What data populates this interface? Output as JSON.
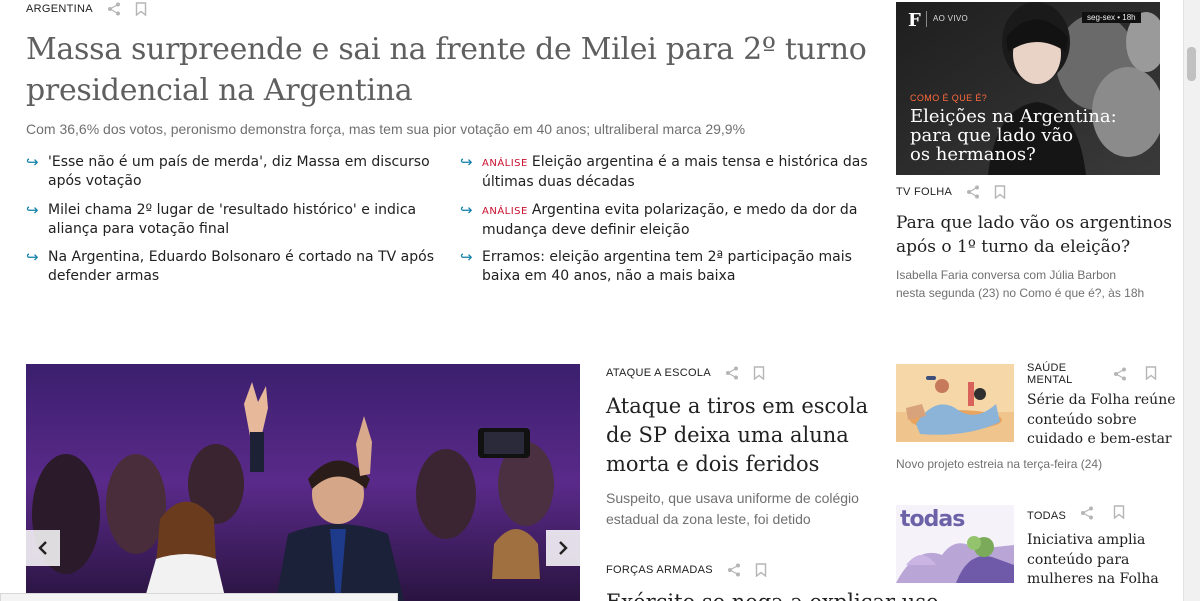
{
  "top_story": {
    "kicker": "ARGENTINA",
    "headline_line1": "Massa surpreende e sai na frente de Milei para 2º turno",
    "headline_line2": "presidencial na Argentina",
    "subtitle": "Com 36,6% dos votos, peronismo demonstra força, mas tem sua pior votação em 40 anos; ultraliberal marca 29,9%",
    "related": [
      {
        "tag": "",
        "text_line1": "'Esse não é um país de merda', diz Massa em discurso",
        "text_line2": "após votação"
      },
      {
        "tag": "",
        "text_line1": "Milei chama 2º lugar de 'resultado histórico' e indica",
        "text_line2": "aliança para votação final"
      },
      {
        "tag": "",
        "text_line1": "Na Argentina, Eduardo Bolsonaro é cortado na TV após",
        "text_line2": "defender armas"
      },
      {
        "tag": "ANÁLISE",
        "text_line1": "Eleição argentina é a mais tensa e histórica das",
        "text_line2": "últimas duas décadas"
      },
      {
        "tag": "ANÁLISE",
        "text_line1": "Argentina evita polarização, e medo da dor da",
        "text_line2": "mudança deve definir eleição"
      },
      {
        "tag": "",
        "text_line1": "Erramos: eleição argentina tem 2ª participação mais",
        "text_line2": "baixa em 40 anos, não a mais baixa"
      }
    ]
  },
  "video_card": {
    "logo": "F",
    "live_label": "AO VIVO",
    "schedule": "seg-sex • 18h",
    "kicker": "COMO É QUE É?",
    "title_line1": "Eleições na Argentina:",
    "title_line2": "para que lado vão",
    "title_line3": "os hermanos?",
    "section": "TV FOLHA",
    "headline_line1": "Para que lado vão os argentinos",
    "headline_line2": "após o 1º turno da eleição?",
    "desc_line1": "Isabella Faria conversa com Júlia Barbon",
    "desc_line2": "nesta segunda (23) no Como é que é?, às 18h"
  },
  "middle": {
    "story1": {
      "kicker": "ATAQUE A ESCOLA",
      "title_line1": "Ataque a tiros em escola",
      "title_line2": "de SP deixa uma aluna",
      "title_line3": "morta e dois feridos",
      "sub_line1": "Suspeito, que usava uniforme de colégio",
      "sub_line2": "estadual da zona leste, foi detido"
    },
    "story2": {
      "kicker": "FORÇAS ARMADAS",
      "title_partial": "Exército se nega a explicar uso"
    }
  },
  "right": {
    "story1": {
      "kicker_line1": "SAÚDE",
      "kicker_line2": "MENTAL",
      "title_line1": "Série da Folha reúne",
      "title_line2": "conteúdo sobre",
      "title_line3": "cuidado e bem-estar",
      "note": "Novo projeto estreia na terça-feira (24)"
    },
    "story2": {
      "kicker": "TODAS",
      "logo_text": "todas",
      "title_line1": "Iniciativa amplia",
      "title_line2": "conteúdo para",
      "title_line3": "mulheres na Folha"
    }
  },
  "colors": {
    "accent_link": "#0f7fa8",
    "analysis_tag": "#c8102e",
    "headline_grey": "#5f5f5f"
  }
}
